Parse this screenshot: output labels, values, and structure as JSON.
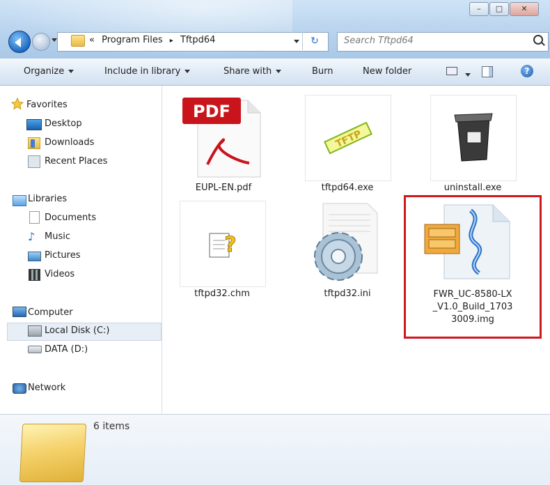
{
  "window": {
    "controls": {
      "minimize": "–",
      "maximize": "□",
      "close": "✕"
    }
  },
  "address_bar": {
    "prefix": "«",
    "crumbs": [
      "Program Files",
      "Tftpd64"
    ],
    "separator": "▸",
    "search_placeholder": "Search Tftpd64",
    "refresh_glyph": "↻"
  },
  "toolbar": {
    "organize": "Organize",
    "include_in_library": "Include in library",
    "share_with": "Share with",
    "burn": "Burn",
    "new_folder": "New folder",
    "help_glyph": "?"
  },
  "nav_pane": {
    "favorites": {
      "label": "Favorites",
      "items": [
        "Desktop",
        "Downloads",
        "Recent Places"
      ]
    },
    "libraries": {
      "label": "Libraries",
      "items": [
        "Documents",
        "Music",
        "Pictures",
        "Videos"
      ]
    },
    "computer": {
      "label": "Computer",
      "items": [
        "Local Disk (C:)",
        "DATA (D:)"
      ]
    },
    "network": {
      "label": "Network"
    }
  },
  "files": [
    {
      "name": "EUPL-EN.pdf",
      "icon": "pdf-icon",
      "pdf_text": "PDF"
    },
    {
      "name": "tftpd64.exe",
      "icon": "tftp-exe-icon",
      "icon_text": "TFTP"
    },
    {
      "name": "uninstall.exe",
      "icon": "uninstall-icon"
    },
    {
      "name": "tftpd32.chm",
      "icon": "chm-help-icon"
    },
    {
      "name": "tftpd32.ini",
      "icon": "ini-settings-icon"
    },
    {
      "name_lines": [
        "FWR_UC-8580-LX",
        "_V1.0_Build_1703",
        "3009.img"
      ],
      "icon": "img-archive-icon"
    }
  ],
  "details_pane": {
    "item_count": "6 items"
  },
  "colors": {
    "highlight_border": "#d0181f",
    "accent": "#1e6bc6"
  }
}
